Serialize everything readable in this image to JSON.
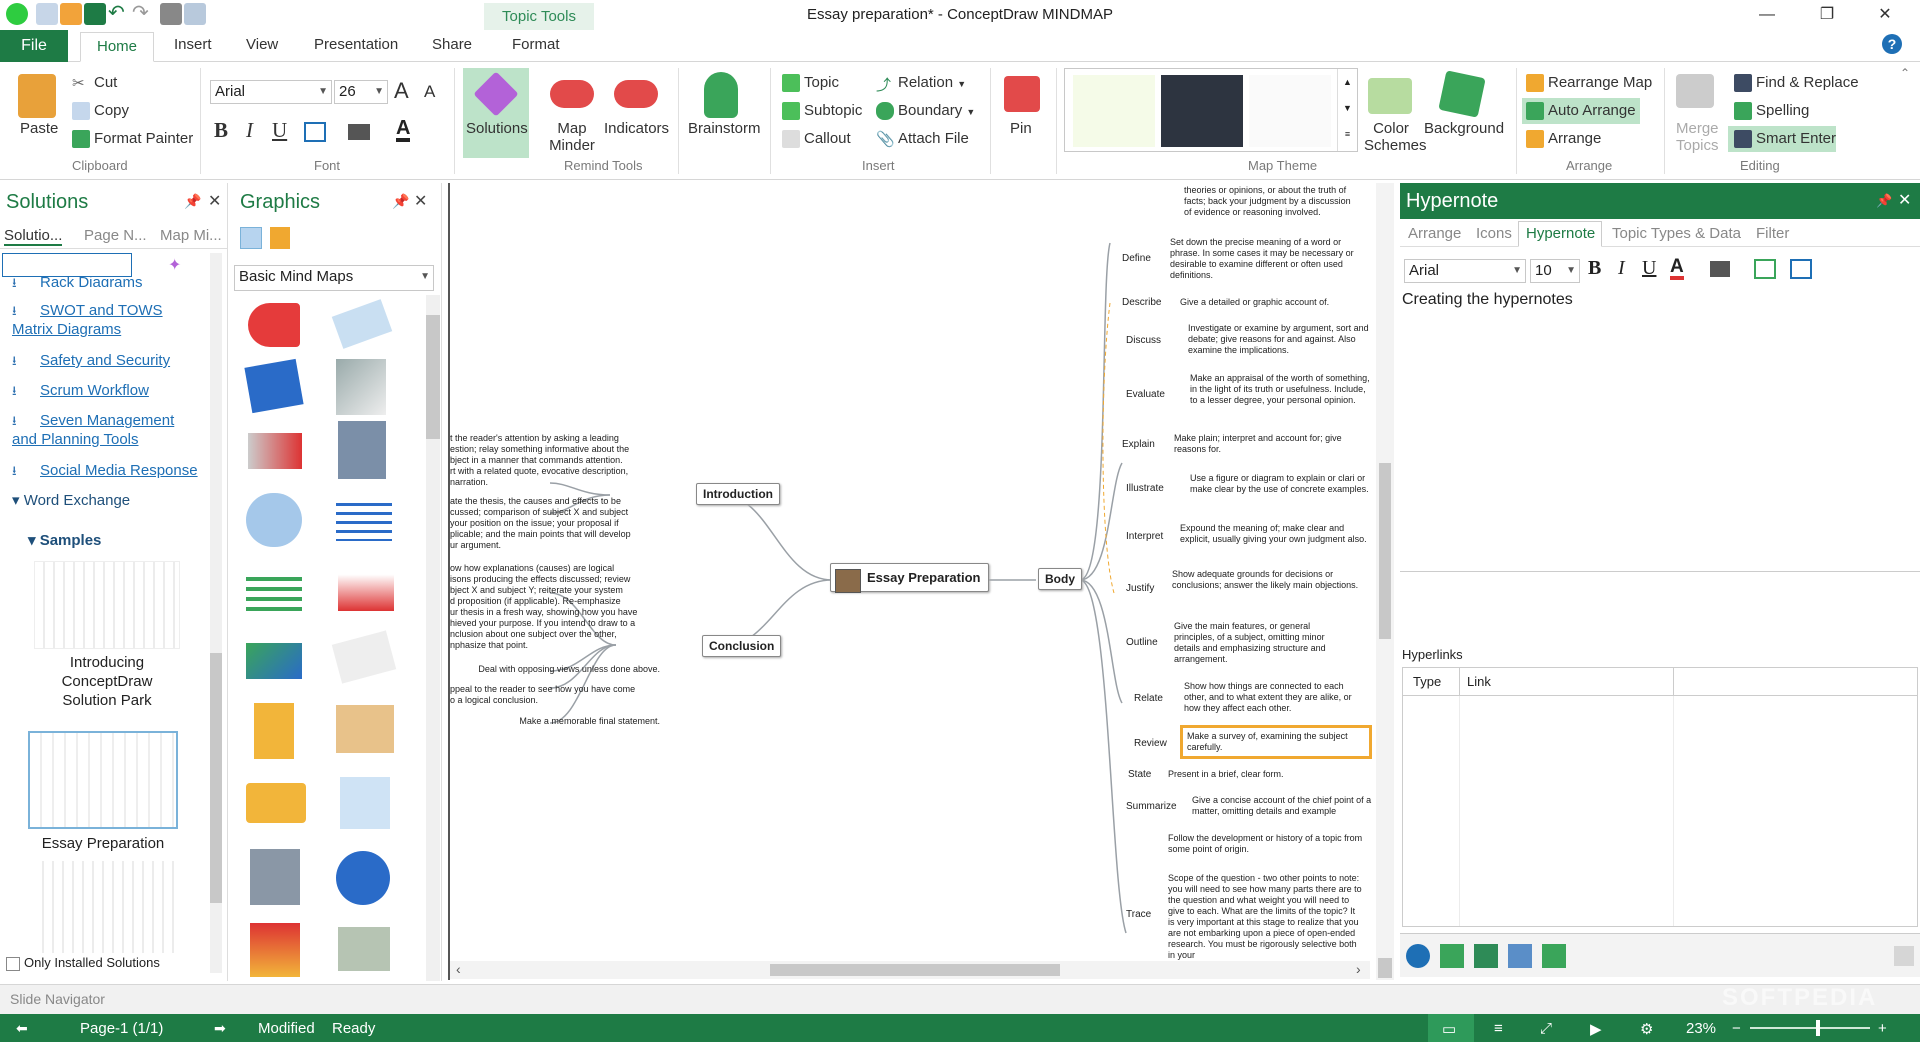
{
  "window": {
    "title": "Essay preparation* - ConceptDraw MINDMAP",
    "context_tab": "Topic Tools"
  },
  "tabs": [
    "File",
    "Home",
    "Insert",
    "View",
    "Presentation",
    "Share",
    "Format"
  ],
  "ribbon": {
    "clipboard": {
      "paste": "Paste",
      "cut": "Cut",
      "copy": "Copy",
      "format_painter": "Format Painter",
      "group": "Clipboard"
    },
    "font": {
      "family": "Arial",
      "size": "26",
      "group": "Font",
      "bold": "B",
      "italic": "I",
      "underline": "U",
      "grow": "A",
      "shrink": "A"
    },
    "remind": {
      "solutions": "Solutions",
      "map_minder": "Map Minder",
      "indicators": "Indicators",
      "group": "Remind Tools"
    },
    "brainstorm": "Brainstorm",
    "insert": {
      "topic": "Topic",
      "subtopic": "Subtopic",
      "callout": "Callout",
      "relation": "Relation",
      "boundary": "Boundary",
      "attach_file": "Attach File",
      "group": "Insert"
    },
    "pin": "Pin",
    "theme": {
      "color_schemes": "Color Schemes",
      "background": "Background",
      "group": "Map Theme"
    },
    "arrange": {
      "rearrange_map": "Rearrange Map",
      "auto_arrange": "Auto Arrange",
      "arrange": "Arrange",
      "group": "Arrange"
    },
    "editing": {
      "merge_topics": "Merge Topics",
      "find_replace": "Find & Replace",
      "spelling": "Spelling",
      "smart_enter": "Smart Enter",
      "group": "Editing"
    }
  },
  "solutions_panel": {
    "title": "Solutions",
    "tabs": [
      "Solutio...",
      "Page N...",
      "Map Mi..."
    ],
    "items": [
      "Rack Diagrams",
      "SWOT and TOWS Matrix Diagrams",
      "Safety and Security",
      "Scrum Workflow",
      "Seven Management and Planning Tools",
      "Social Media Response"
    ],
    "group": "Word Exchange",
    "samples": "Samples",
    "sample_items": [
      "Introducing ConceptDraw Solution Park",
      "Essay Preparation"
    ],
    "only_installed": "Only Installed Solutions"
  },
  "graphics_panel": {
    "title": "Graphics",
    "library": "Basic Mind Maps"
  },
  "mindmap": {
    "central": "Essay Preparation",
    "introduction": "Introduction",
    "conclusion": "Conclusion",
    "body": "Body",
    "intro_desc": [
      "t the reader's attention by asking a leading",
      "estion; relay something informative about the",
      "bject in a manner that commands attention.",
      "rt with a related quote, evocative description,",
      "narration.",
      "ate the thesis, the causes and effects to be",
      "cussed; comparison of subject X and subject",
      "your position on the issue; your proposal if",
      "plicable; and the main points that will develop",
      "ur argument."
    ],
    "concl_desc": [
      "ow how explanations (causes) are logical",
      "isons producing the effects discussed; review",
      "bject X and subject Y; reiterate your system",
      "d proposition (if applicable). Re-emphasize",
      "ur thesis in a fresh way, showing how you have",
      "hieved your purpose. If you intend to draw to a",
      "nclusion about one subject over the other,",
      "nphasize that point."
    ],
    "concl_items": [
      "Deal with opposing views unless done above.",
      "ppeal to the reader to see how you have come",
      "o a logical conclusion.",
      "Make a memorable final statement."
    ],
    "body_top_desc": [
      "theories or opinions, or about the truth of",
      "facts; back your judgment by a discussion",
      "of evidence or reasoning involved."
    ],
    "branches": [
      {
        "label": "Define",
        "desc": "Set down the precise meaning of a word or phrase. In some cases it may be necessary or desirable to examine different or often used definitions."
      },
      {
        "label": "Describe",
        "desc": "Give a detailed or graphic account of."
      },
      {
        "label": "Discuss",
        "desc": "Investigate or examine by argument, sort and debate; give reasons for and against. Also examine the implications."
      },
      {
        "label": "Evaluate",
        "desc": "Make an appraisal of the worth of something, in the light of its truth or usefulness. Include, to a lesser degree, your personal opinion."
      },
      {
        "label": "Explain",
        "desc": "Make plain; interpret and account for; give reasons for."
      },
      {
        "label": "Illustrate",
        "desc": "Use a figure or diagram to explain or clari or make clear by the use of concrete examples."
      },
      {
        "label": "Interpret",
        "desc": "Expound the meaning of; make clear and explicit, usually giving your own judgment also."
      },
      {
        "label": "Justify",
        "desc": "Show adequate grounds for decisions or conclusions; answer the likely main objections."
      },
      {
        "label": "Outline",
        "desc": "Give the main features, or general principles, of a subject, omitting minor details and emphasizing structure and arrangement."
      },
      {
        "label": "Relate",
        "desc": "Show how things are connected to each other, and to what extent they are alike, or how they affect each other."
      },
      {
        "label": "Review",
        "desc": "Make a survey of, examining the subject carefully."
      },
      {
        "label": "State",
        "desc": "Present in a brief, clear form."
      },
      {
        "label": "Summarize",
        "desc": "Give a concise account of the chief point of a matter, omitting details and example"
      },
      {
        "label": "Trace",
        "desc": "Follow the development or history of a topic from some point of origin."
      }
    ],
    "trace_extra": "Scope of the question - two other points to note: you will need to see how many parts there are to the question and what weight you will need to give to each. What are the limits of the topic? It is very important at this stage to realize that you are not embarking upon a piece of open-ended research. You must be rigorously selective both in your"
  },
  "hypernote_panel": {
    "title": "Hypernote",
    "tabs": [
      "Arrange",
      "Icons",
      "Hypernote",
      "Topic Types & Data",
      "Filter"
    ],
    "font": "Arial",
    "size": "10",
    "text": "Creating the hypernotes",
    "hyperlinks": "Hyperlinks",
    "columns": [
      "Type",
      "Link"
    ]
  },
  "slide_navigator": "Slide Navigator",
  "status": {
    "page": "Page-1 (1/1)",
    "modified": "Modified",
    "ready": "Ready",
    "zoom": "23%",
    "watermark": "SOFTPEDIA"
  },
  "colors": {
    "accent": "#1e7b45",
    "link": "#1e6fb5",
    "selection": "#f0a830"
  }
}
